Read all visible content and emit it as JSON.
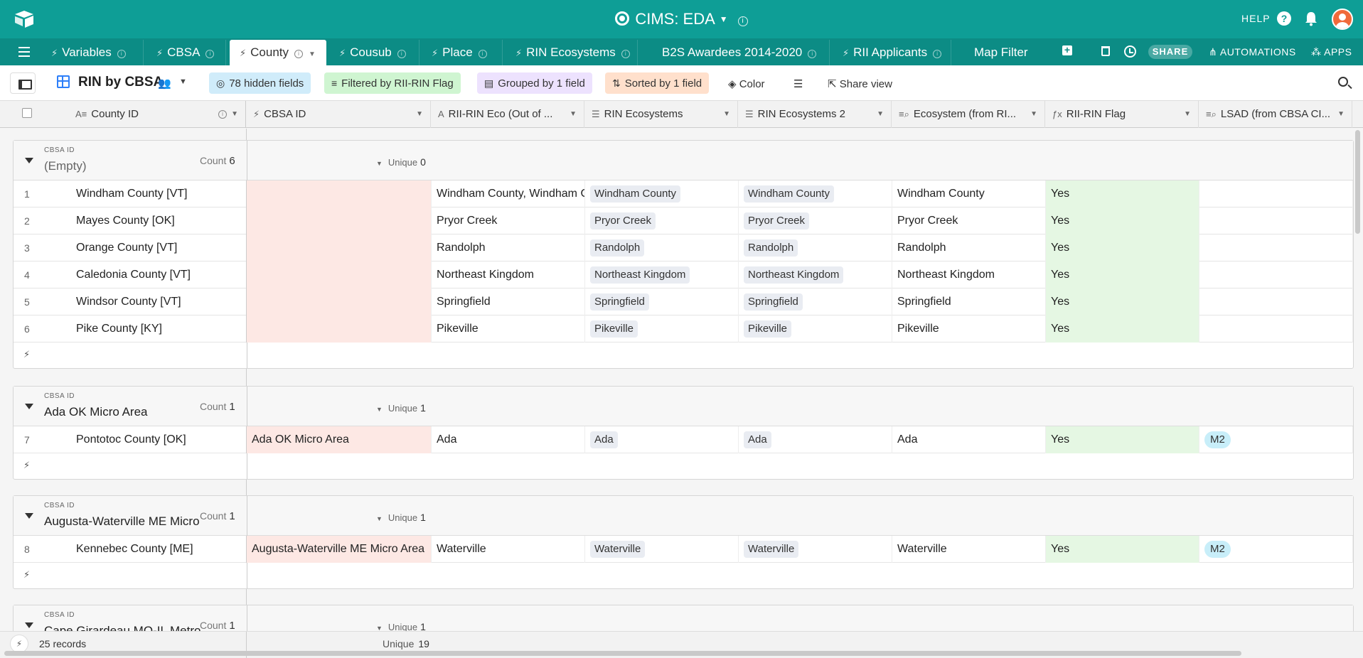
{
  "topbar": {
    "title": "CIMS: EDA",
    "help_label": "HELP"
  },
  "tabs": [
    {
      "label": "Variables",
      "active": false
    },
    {
      "label": "CBSA",
      "active": false
    },
    {
      "label": "County",
      "active": true
    },
    {
      "label": "Cousub",
      "active": false
    },
    {
      "label": "Place",
      "active": false
    },
    {
      "label": "RIN Ecosystems",
      "active": false
    },
    {
      "label": "B2S Awardees 2014-2020",
      "active": false
    },
    {
      "label": "RII Applicants",
      "active": false
    },
    {
      "label": "Map Filter",
      "active": false
    }
  ],
  "tabbar_actions": {
    "share_label": "SHARE",
    "automations_label": "AUTOMATIONS",
    "apps_label": "APPS"
  },
  "viewbar": {
    "view_name": "RIN by CBSA",
    "hidden_fields": "78 hidden fields",
    "filter": "Filtered by RII-RIN Flag",
    "group": "Grouped by 1 field",
    "sort": "Sorted by 1 field",
    "color_label": "Color",
    "share_view_label": "Share view"
  },
  "columns": [
    {
      "key": "county_id",
      "label": "County ID"
    },
    {
      "key": "cbsa_id",
      "label": "CBSA ID"
    },
    {
      "key": "rii_rin_eco",
      "label": "RII-RIN Eco (Out of ..."
    },
    {
      "key": "rin_ecosystems",
      "label": "RIN Ecosystems"
    },
    {
      "key": "rin_ecosystems_2",
      "label": "RIN Ecosystems 2"
    },
    {
      "key": "ecosystem_from",
      "label": "Ecosystem (from RI..."
    },
    {
      "key": "rii_rin_flag",
      "label": "RII-RIN Flag"
    },
    {
      "key": "lsad",
      "label": "LSAD (from CBSA CI..."
    }
  ],
  "groups": [
    {
      "field_label": "CBSA ID",
      "value": "(Empty)",
      "count_label": "Count",
      "count": "6",
      "unique_label": "Unique",
      "unique": "0",
      "rows": [
        {
          "num": "1",
          "county": "Windham County [VT]",
          "cbsa": "",
          "eco": "Windham County, Windham County",
          "rin1": "Windham County",
          "rin2": "Windham County",
          "ecofrom": "Windham County",
          "flag": "Yes",
          "lsad": ""
        },
        {
          "num": "2",
          "county": "Mayes County [OK]",
          "cbsa": "",
          "eco": "Pryor Creek",
          "rin1": "Pryor Creek",
          "rin2": "Pryor Creek",
          "ecofrom": "Pryor Creek",
          "flag": "Yes",
          "lsad": ""
        },
        {
          "num": "3",
          "county": "Orange County [VT]",
          "cbsa": "",
          "eco": "Randolph",
          "rin1": "Randolph",
          "rin2": "Randolph",
          "ecofrom": "Randolph",
          "flag": "Yes",
          "lsad": ""
        },
        {
          "num": "4",
          "county": "Caledonia County [VT]",
          "cbsa": "",
          "eco": "Northeast Kingdom",
          "rin1": "Northeast Kingdom",
          "rin2": "Northeast Kingdom",
          "ecofrom": "Northeast Kingdom",
          "flag": "Yes",
          "lsad": ""
        },
        {
          "num": "5",
          "county": "Windsor County [VT]",
          "cbsa": "",
          "eco": "Springfield",
          "rin1": "Springfield",
          "rin2": "Springfield",
          "ecofrom": "Springfield",
          "flag": "Yes",
          "lsad": ""
        },
        {
          "num": "6",
          "county": "Pike County [KY]",
          "cbsa": "",
          "eco": "Pikeville",
          "rin1": "Pikeville",
          "rin2": "Pikeville",
          "ecofrom": "Pikeville",
          "flag": "Yes",
          "lsad": ""
        }
      ]
    },
    {
      "field_label": "CBSA ID",
      "value": "Ada OK Micro Area",
      "count_label": "Count",
      "count": "1",
      "unique_label": "Unique",
      "unique": "1",
      "rows": [
        {
          "num": "7",
          "county": "Pontotoc County [OK]",
          "cbsa": "Ada OK Micro Area",
          "eco": "Ada",
          "rin1": "Ada",
          "rin2": "Ada",
          "ecofrom": "Ada",
          "flag": "Yes",
          "lsad": "M2"
        }
      ]
    },
    {
      "field_label": "CBSA ID",
      "value": "Augusta-Waterville ME Micro Area",
      "count_label": "Count",
      "count": "1",
      "unique_label": "Unique",
      "unique": "1",
      "rows": [
        {
          "num": "8",
          "county": "Kennebec County [ME]",
          "cbsa": "Augusta-Waterville ME Micro Area",
          "eco": "Waterville",
          "rin1": "Waterville",
          "rin2": "Waterville",
          "ecofrom": "Waterville",
          "flag": "Yes",
          "lsad": "M2"
        }
      ]
    },
    {
      "field_label": "CBSA ID",
      "value": "Cape Girardeau MO-IL Metro Area",
      "count_label": "Count",
      "count": "1",
      "unique_label": "Unique",
      "unique": "1",
      "rows": []
    }
  ],
  "footer": {
    "records": "25 records",
    "unique_label": "Unique",
    "unique": "19"
  }
}
